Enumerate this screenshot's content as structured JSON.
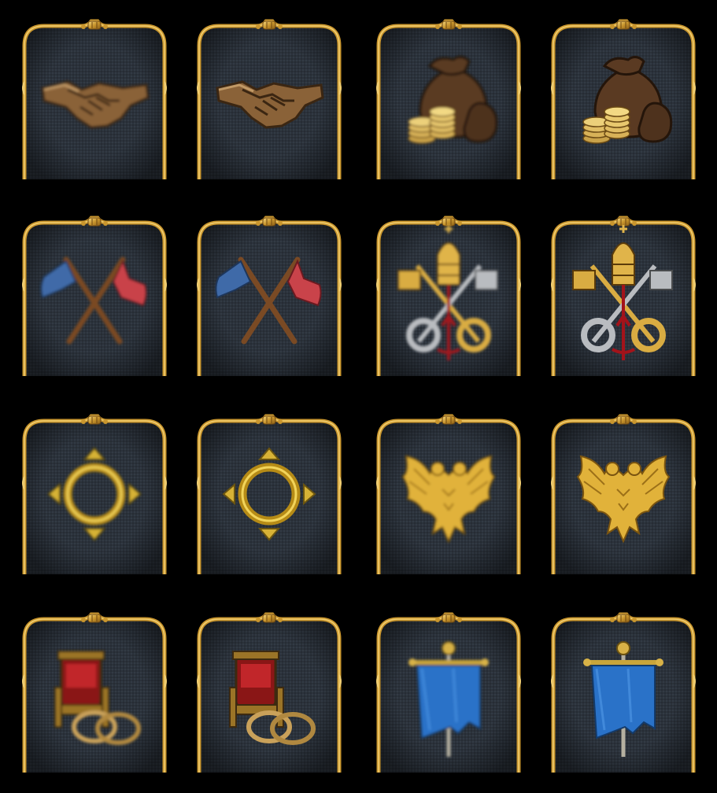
{
  "colors": {
    "background": "#000000",
    "panel": "#2b323b",
    "frame_gold": "#c9962e",
    "frame_highlight": "#f2cf72"
  },
  "tiles": [
    {
      "icon": "handshake-icon",
      "variant": "blurred"
    },
    {
      "icon": "handshake-icon",
      "variant": "sharp"
    },
    {
      "icon": "money-bags-icon",
      "variant": "blurred"
    },
    {
      "icon": "money-bags-icon",
      "variant": "sharp"
    },
    {
      "icon": "crossed-flags-icon",
      "variant": "blurred"
    },
    {
      "icon": "crossed-flags-icon",
      "variant": "sharp"
    },
    {
      "icon": "papal-keys-icon",
      "variant": "blurred"
    },
    {
      "icon": "papal-keys-icon",
      "variant": "sharp"
    },
    {
      "icon": "gold-ring-arrows-icon",
      "variant": "blurred"
    },
    {
      "icon": "gold-ring-arrows-icon",
      "variant": "sharp"
    },
    {
      "icon": "double-headed-eagle-icon",
      "variant": "blurred"
    },
    {
      "icon": "double-headed-eagle-icon",
      "variant": "sharp"
    },
    {
      "icon": "throne-rings-icon",
      "variant": "blurred"
    },
    {
      "icon": "throne-rings-icon",
      "variant": "sharp"
    },
    {
      "icon": "blue-banner-icon",
      "variant": "blurred"
    },
    {
      "icon": "blue-banner-icon",
      "variant": "sharp"
    }
  ]
}
